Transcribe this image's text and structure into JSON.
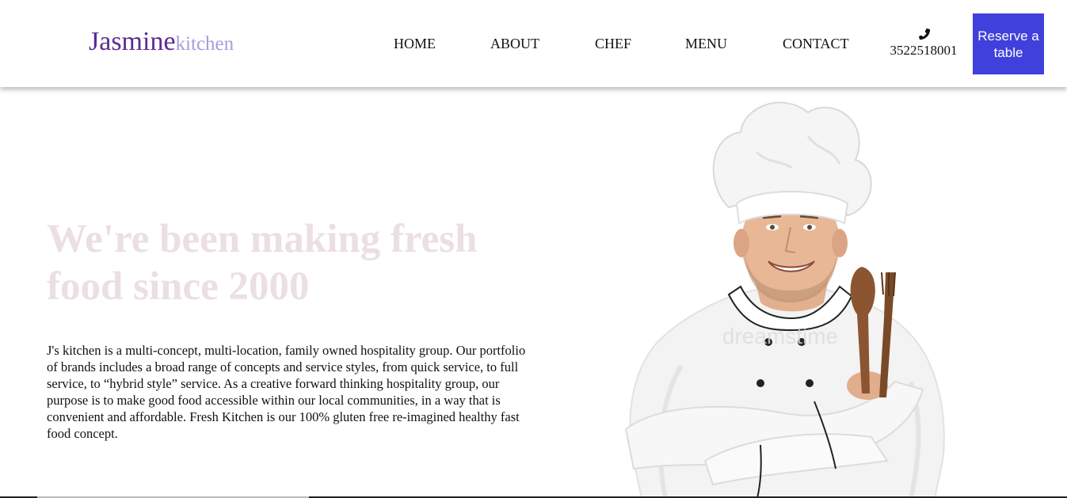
{
  "brand": {
    "name_main": "Jasmine",
    "name_sub": "kitchen",
    "main_color": "#5b2c91",
    "sub_color": "#a99be0"
  },
  "nav": {
    "items": [
      {
        "label": "HOME"
      },
      {
        "label": "ABOUT"
      },
      {
        "label": "CHEF"
      },
      {
        "label": "MENU"
      },
      {
        "label": "CONTACT"
      }
    ]
  },
  "contact": {
    "icon": "phone-icon",
    "phone": "3522518001"
  },
  "reserve": {
    "label": "Reserve a table",
    "color": "#4040dd"
  },
  "hero": {
    "title": "We're been making fresh food since 2000",
    "title_color": "#ecdfe2",
    "description": "J's kitchen is a multi-concept, multi-location, family owned hospitality group. Our portfolio of brands includes a broad range of concepts and service styles, from quick service, to full service, to “hybrid style” service. As a creative forward thinking hospitality group, our purpose is to make good food accessible within our local communities, in a way that is convenient and affordable. Fresh Kitchen is our 100% gluten free re-imagined healthy fast food concept."
  },
  "image": {
    "subject": "chef-with-wooden-spoons",
    "watermark": "dreamstime"
  }
}
